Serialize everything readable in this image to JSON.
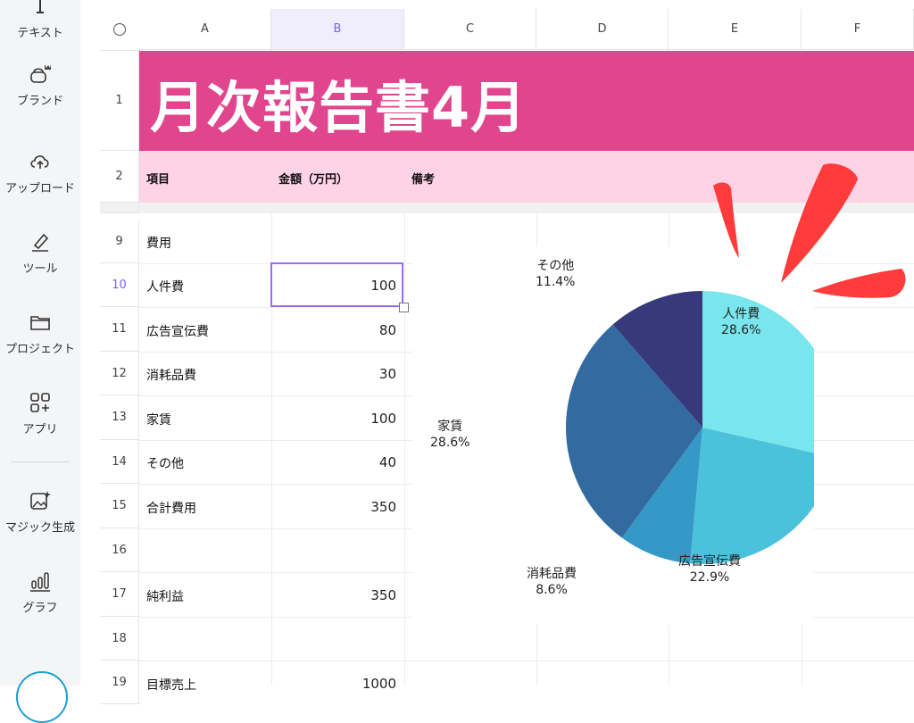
{
  "sidebar": {
    "items": [
      {
        "label": "テキスト",
        "icon": "text-icon"
      },
      {
        "label": "ブランド",
        "icon": "brand-crown-icon"
      },
      {
        "label": "アップロード",
        "icon": "upload-cloud-icon"
      },
      {
        "label": "ツール",
        "icon": "pen-tool-icon"
      },
      {
        "label": "プロジェクト",
        "icon": "folder-icon"
      },
      {
        "label": "アプリ",
        "icon": "apps-grid-icon"
      },
      {
        "label": "マジック生成",
        "icon": "magic-image-icon"
      },
      {
        "label": "グラフ",
        "icon": "bar-chart-icon"
      }
    ]
  },
  "sheet": {
    "columns": [
      "A",
      "B",
      "C",
      "D",
      "E",
      "F"
    ],
    "active_column": "B",
    "rows_visible": [
      "1",
      "2",
      "9",
      "10",
      "11",
      "12",
      "13",
      "14",
      "15",
      "16",
      "17",
      "18",
      "19"
    ],
    "active_row": "10",
    "title": "月次報告書4月",
    "headers": {
      "item": "項目",
      "amount": "金額（万円）",
      "note": "備考"
    },
    "data_rows": [
      {
        "row": "9",
        "label": "費用",
        "value": ""
      },
      {
        "row": "10",
        "label": "人件費",
        "value": "100"
      },
      {
        "row": "11",
        "label": "広告宣伝費",
        "value": "80"
      },
      {
        "row": "12",
        "label": "消耗品費",
        "value": "30"
      },
      {
        "row": "13",
        "label": "家賃",
        "value": "100"
      },
      {
        "row": "14",
        "label": "その他",
        "value": "40"
      },
      {
        "row": "15",
        "label": "合計費用",
        "value": "350"
      },
      {
        "row": "16",
        "label": "",
        "value": ""
      },
      {
        "row": "17",
        "label": "純利益",
        "value": "350"
      },
      {
        "row": "18",
        "label": "",
        "value": ""
      },
      {
        "row": "19",
        "label": "目標売上",
        "value": "1000"
      }
    ]
  },
  "colors": {
    "title_bg": "#e0458d",
    "header_bg": "#ffd3e6",
    "selection": "#9a6cf0",
    "accent_strokes": "#ff3b3b"
  },
  "chart_data": {
    "type": "pie",
    "slices": [
      {
        "label": "人件費",
        "percent": "28.6%",
        "value": 28.6,
        "color": "#78e6ec"
      },
      {
        "label": "広告宣伝費",
        "percent": "22.9%",
        "value": 22.9,
        "color": "#4bc1dc"
      },
      {
        "label": "消耗品費",
        "percent": "8.6%",
        "value": 8.6,
        "color": "#3598c6"
      },
      {
        "label": "家賃",
        "percent": "28.6%",
        "value": 28.6,
        "color": "#336aa0"
      },
      {
        "label": "その他",
        "percent": "11.4%",
        "value": 11.4,
        "color": "#36397a"
      }
    ]
  }
}
